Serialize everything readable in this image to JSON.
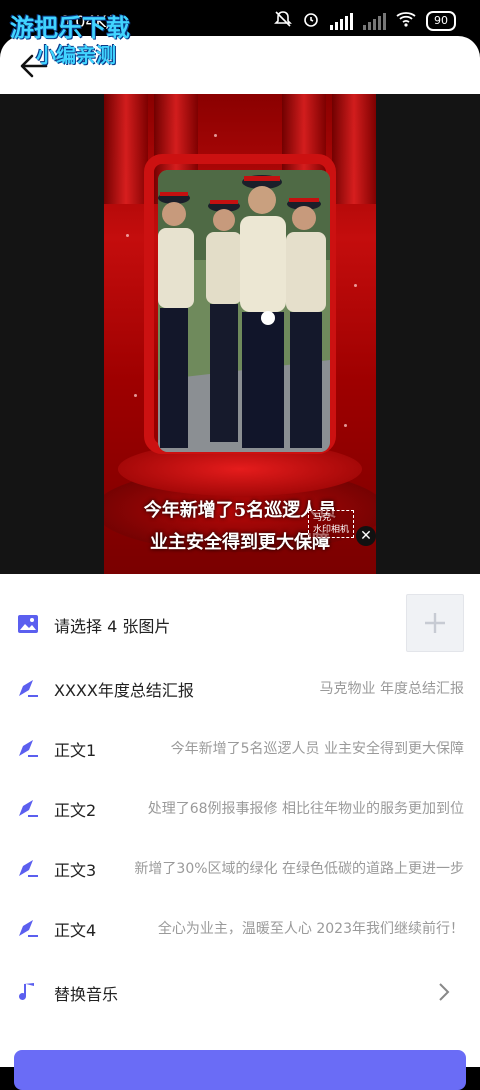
{
  "status_bar": {
    "speed": "0.04K/s",
    "battery": "90"
  },
  "watermark": {
    "line1": "游把乐下载",
    "line2": "小编亲测"
  },
  "preview": {
    "caption_line1": "今年新增了5名巡逻人员",
    "caption_line2": "业主安全得到更大保障",
    "tag_line1": "马克",
    "tag_line2": "水印相机"
  },
  "form": {
    "image_row": {
      "label": "请选择 4 张图片",
      "icon": "image-icon",
      "add_icon": "plus-icon"
    },
    "title_row": {
      "label": "XXXX年度总结汇报",
      "value": "马克物业 年度总结汇报",
      "icon": "edit-icon"
    },
    "body_rows": [
      {
        "label": "正文1",
        "value": "今年新增了5名巡逻人员 业主安全得到更大保障"
      },
      {
        "label": "正文2",
        "value": "处理了68例报事报修 相比往年物业的服务更加到位"
      },
      {
        "label": "正文3",
        "value": "新增了30%区域的绿化 在绿色低碳的道路上更进一步"
      },
      {
        "label": "正文4",
        "value": "全心为业主，温暖至人心 2023年我们继续前行！"
      }
    ],
    "music_row": {
      "label": "替换音乐",
      "icon": "music-note-icon"
    }
  },
  "colors": {
    "accent": "#5b5fef",
    "cta": "#6a6cf6",
    "muted_text": "#9a9a9a"
  }
}
